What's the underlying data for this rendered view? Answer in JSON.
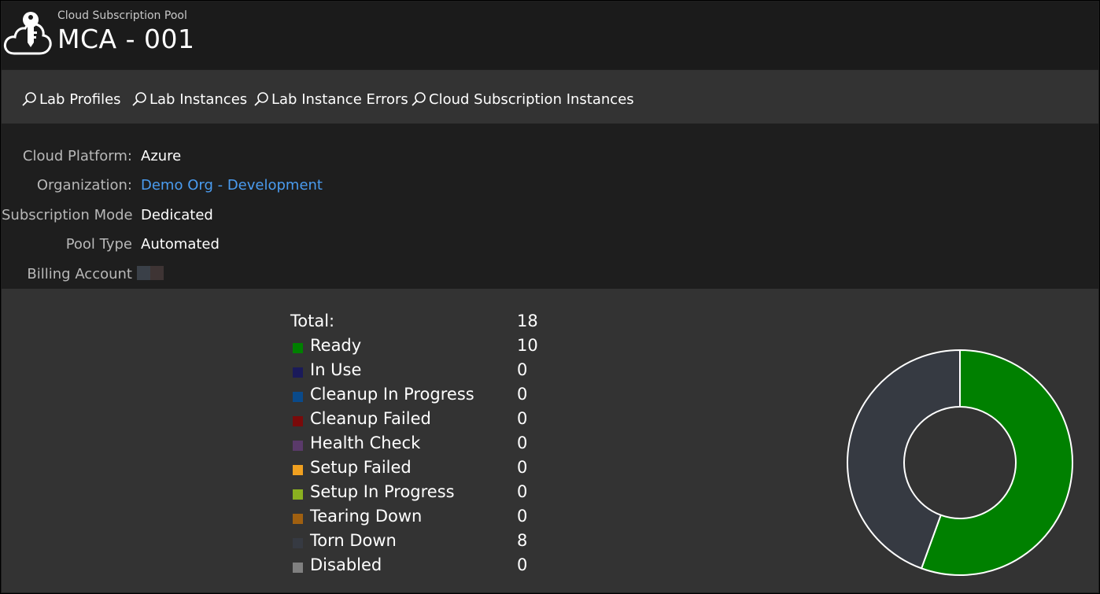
{
  "header": {
    "subtitle": "Cloud Subscription Pool",
    "title": "MCA - 001",
    "logo_icon": "cloud-key-icon"
  },
  "nav": {
    "items": [
      {
        "label": "Lab Profiles",
        "icon": "search-icon"
      },
      {
        "label": "Lab Instances",
        "icon": "search-icon"
      },
      {
        "label": "Lab Instance Errors",
        "icon": "search-icon"
      },
      {
        "label": "Cloud Subscription Instances",
        "icon": "search-icon"
      }
    ]
  },
  "details": {
    "cloud_platform": {
      "label": "Cloud Platform:",
      "value": "Azure"
    },
    "organization": {
      "label": "Organization:",
      "value": "Demo Org - Development"
    },
    "subscription_mode": {
      "label": "Subscription Mode",
      "value": "Dedicated"
    },
    "pool_type": {
      "label": "Pool Type",
      "value": "Automated"
    },
    "billing_account": {
      "label": "Billing Account",
      "value_redacted_colors": [
        "#3a4048",
        "#3e3434"
      ]
    }
  },
  "stats": {
    "total": {
      "label": "Total:",
      "value": "18"
    },
    "items": [
      {
        "label": "Ready",
        "value": "10",
        "color": "#008000"
      },
      {
        "label": "In Use",
        "value": "0",
        "color": "#1a1a5a"
      },
      {
        "label": "Cleanup In Progress",
        "value": "0",
        "color": "#0a4a8a"
      },
      {
        "label": "Cleanup Failed",
        "value": "0",
        "color": "#7a0a0a"
      },
      {
        "label": "Health Check",
        "value": "0",
        "color": "#5a3a6a"
      },
      {
        "label": "Setup Failed",
        "value": "0",
        "color": "#f0a020"
      },
      {
        "label": "Setup In Progress",
        "value": "0",
        "color": "#8ab020"
      },
      {
        "label": "Tearing Down",
        "value": "0",
        "color": "#a06010"
      },
      {
        "label": "Torn Down",
        "value": "8",
        "color": "#363a42"
      },
      {
        "label": "Disabled",
        "value": "0",
        "color": "#808080"
      }
    ]
  },
  "chart_data": {
    "type": "pie",
    "categories": [
      "Ready",
      "In Use",
      "Cleanup In Progress",
      "Cleanup Failed",
      "Health Check",
      "Setup Failed",
      "Setup In Progress",
      "Tearing Down",
      "Torn Down",
      "Disabled"
    ],
    "values": [
      10,
      0,
      0,
      0,
      0,
      0,
      0,
      0,
      8,
      0
    ],
    "colors": [
      "#008000",
      "#1a1a5a",
      "#0a4a8a",
      "#7a0a0a",
      "#5a3a6a",
      "#f0a020",
      "#8ab020",
      "#a06010",
      "#363a42",
      "#808080"
    ],
    "donut": true
  }
}
